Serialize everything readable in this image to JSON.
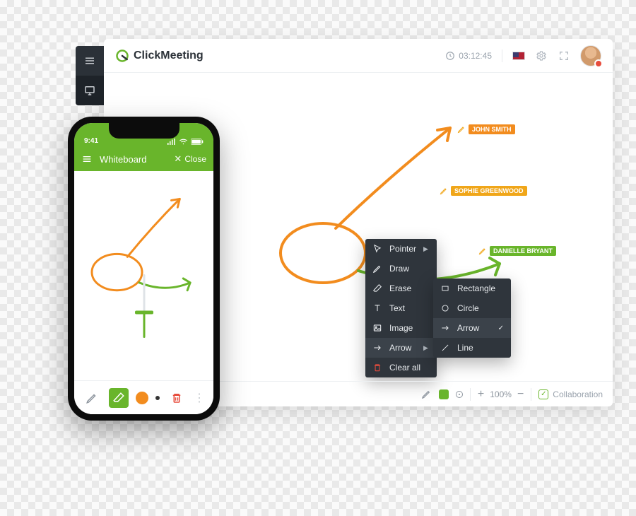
{
  "brand": {
    "name": "ClickMeeting"
  },
  "timer": "03:12:45",
  "zoom": {
    "percent": "100%"
  },
  "collaboration_label": "Collaboration",
  "participants": [
    {
      "name": "JOHN SMITH",
      "color": "orange"
    },
    {
      "name": "SOPHIE GREENWOOD",
      "color": "yellow"
    },
    {
      "name": "DANIELLE BRYANT",
      "color": "green"
    }
  ],
  "tools_menu": {
    "items": [
      {
        "icon": "pointer",
        "label": "Pointer",
        "submenu": true
      },
      {
        "icon": "draw",
        "label": "Draw"
      },
      {
        "icon": "erase",
        "label": "Erase"
      },
      {
        "icon": "text",
        "label": "Text"
      },
      {
        "icon": "image",
        "label": "Image"
      },
      {
        "icon": "arrow",
        "label": "Arrow",
        "submenu": true,
        "active": true
      },
      {
        "icon": "trash",
        "label": "Clear all",
        "danger": true
      }
    ],
    "shape_submenu": [
      {
        "icon": "rectangle",
        "label": "Rectangle"
      },
      {
        "icon": "circle",
        "label": "Circle"
      },
      {
        "icon": "arrow",
        "label": "Arrow",
        "selected": true
      },
      {
        "icon": "line",
        "label": "Line"
      }
    ]
  },
  "phone": {
    "time": "9:41",
    "header_title": "Whiteboard",
    "close_label": "Close"
  },
  "colors": {
    "green": "#69b52b",
    "orange": "#f28c1e",
    "yellow": "#f0a619",
    "dark": "#2f353c"
  }
}
